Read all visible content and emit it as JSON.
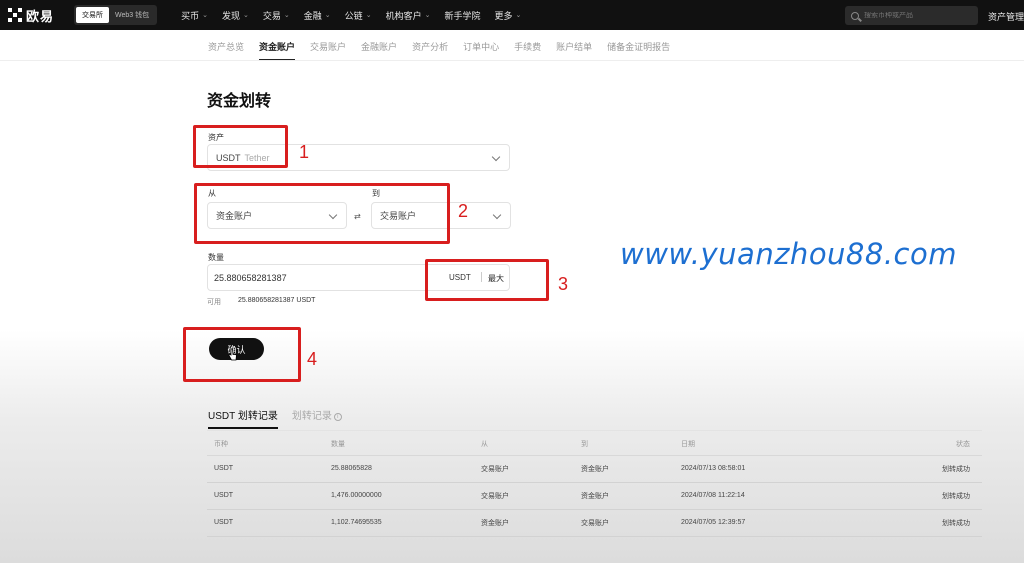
{
  "topnav": {
    "brand": "欧易",
    "mode_exchange": "交易所",
    "mode_web3": "Web3 钱包",
    "menu": [
      "买币",
      "发现",
      "交易",
      "金融",
      "公链",
      "机构客户",
      "新手学院",
      "更多"
    ],
    "search_placeholder": "搜索币种或产品",
    "asset_manage": "资产管理"
  },
  "subnav": {
    "items": [
      "资产总览",
      "资金账户",
      "交易账户",
      "金融账户",
      "资产分析",
      "订单中心",
      "手续费",
      "账户结单",
      "储备金证明报告"
    ],
    "active": "资金账户"
  },
  "form": {
    "title": "资金划转",
    "asset_label": "资产",
    "asset_value": "USDT",
    "asset_sub": "Tether",
    "from_label": "从",
    "from_value": "资金账户",
    "swap_symbol": "⇄",
    "to_label": "到",
    "to_value": "交易账户",
    "amount_label": "数量",
    "amount_value": "25.880658281387",
    "amount_unit": "USDT",
    "max_label": "最大",
    "available_label": "可用",
    "available_value": "25.880658281387 USDT",
    "confirm_label": "确认"
  },
  "annotations": [
    "1",
    "2",
    "3",
    "4"
  ],
  "watermark": "www.yuanzhou88.com",
  "records": {
    "tab_active": "USDT 划转记录",
    "tab_other": "划转记录",
    "columns": [
      "币种",
      "数量",
      "从",
      "到",
      "日期",
      "状态"
    ],
    "rows": [
      [
        "USDT",
        "25.88065828",
        "交易账户",
        "资金账户",
        "2024/07/13 08:58:01",
        "划转成功"
      ],
      [
        "USDT",
        "1,476.00000000",
        "交易账户",
        "资金账户",
        "2024/07/08 11:22:14",
        "划转成功"
      ],
      [
        "USDT",
        "1,102.74695535",
        "资金账户",
        "交易账户",
        "2024/07/05 12:39:57",
        "划转成功"
      ]
    ]
  },
  "colors": {
    "annotation": "#d81e1e",
    "watermark": "#1d6fd1",
    "nav_bg": "#111111"
  }
}
